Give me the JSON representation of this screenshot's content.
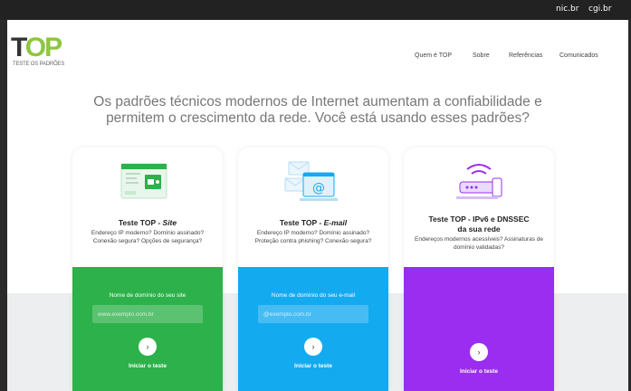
{
  "topbar": {
    "links": [
      "nic.br",
      "cgi.br"
    ]
  },
  "logo": {
    "text": "TOP",
    "subtitle": "TESTE OS PADRÕES"
  },
  "nav": {
    "items": [
      "Quem é TOP",
      "Sobre",
      "Referências",
      "Comunicados"
    ]
  },
  "hero": {
    "line1": "Os padrões técnicos modernos de Internet aumentam a confiabilidade e",
    "line2": "permitem o crescimento da rede. Você está usando esses padrões?"
  },
  "cards": [
    {
      "title_plain": "Teste TOP - ",
      "title_em": "Site",
      "desc": "Endereço IP moderno? Domínio assinado? Conexão segura? Opções de segurança?",
      "label": "Nome de domínio do seu site",
      "placeholder": "www.exemplo.com.br",
      "run": "Iniciar o teste",
      "color": "#2db14a"
    },
    {
      "title_plain": "Teste TOP - ",
      "title_em": "E-mail",
      "desc": "Endereço IP moderno? Domínio assinado? Proteção contra phishing? Conexão segura?",
      "label": "Nome de domínio do seu e-mail",
      "placeholder": "@exemplo.com.br",
      "run": "Iniciar o teste",
      "color": "#14aaf0"
    },
    {
      "title_line1": "Teste TOP - IPv6 e DNSSEC",
      "title_line2": "da sua rede",
      "desc": "Endereços modernos acessíveis? Assinaturas de domínio validadas?",
      "run": "Iniciar o teste",
      "color": "#9a2df0"
    }
  ]
}
